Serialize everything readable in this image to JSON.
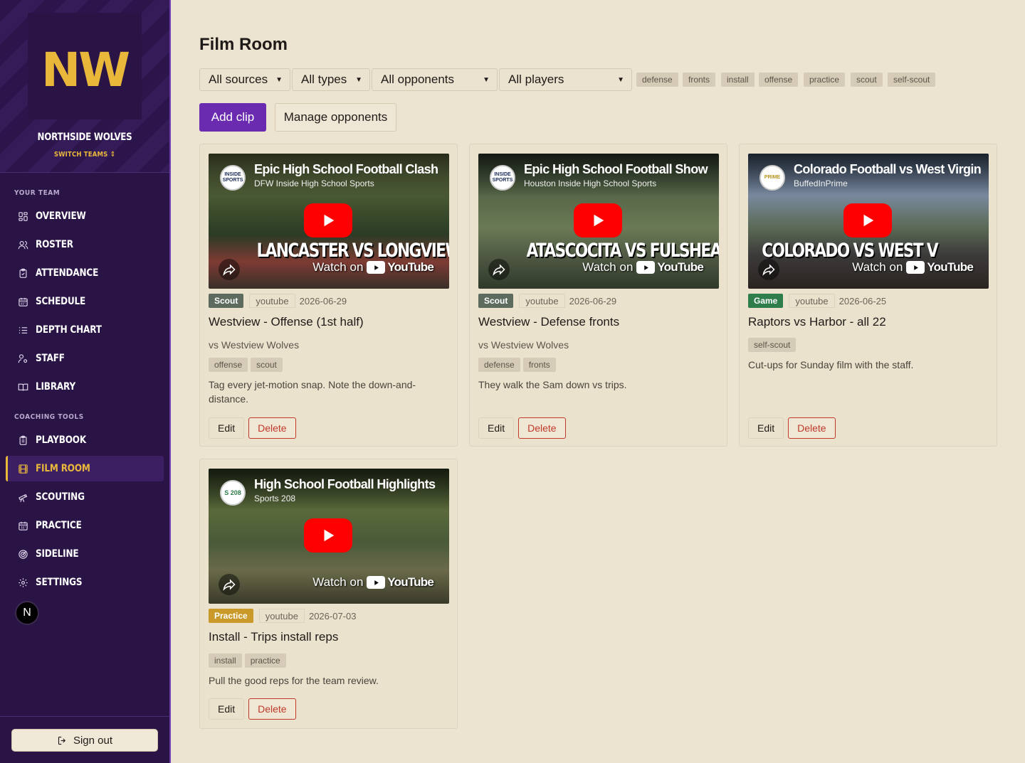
{
  "brand": {
    "logo": "NW",
    "team_name": "NORTHSIDE WOLVES",
    "switch_label": "SWITCH TEAMS"
  },
  "nav": {
    "section_team": "YOUR TEAM",
    "section_tools": "COACHING TOOLS",
    "team_items": [
      {
        "label": "OVERVIEW",
        "icon": "grid-icon"
      },
      {
        "label": "ROSTER",
        "icon": "users-icon"
      },
      {
        "label": "ATTENDANCE",
        "icon": "clipboard-check-icon"
      },
      {
        "label": "SCHEDULE",
        "icon": "calendar-icon"
      },
      {
        "label": "DEPTH CHART",
        "icon": "list-icon"
      },
      {
        "label": "STAFF",
        "icon": "user-key-icon"
      },
      {
        "label": "LIBRARY",
        "icon": "book-icon"
      }
    ],
    "tool_items": [
      {
        "label": "PLAYBOOK",
        "icon": "clipboard-icon"
      },
      {
        "label": "FILM ROOM",
        "icon": "film-icon",
        "active": true
      },
      {
        "label": "SCOUTING",
        "icon": "telescope-icon"
      },
      {
        "label": "PRACTICE",
        "icon": "calendar-grid-icon"
      },
      {
        "label": "SIDELINE",
        "icon": "target-icon"
      },
      {
        "label": "SETTINGS",
        "icon": "gear-icon"
      }
    ],
    "avatar_letter": "N",
    "sign_out": "Sign out"
  },
  "page": {
    "title": "Film Room",
    "filters": {
      "sources": "All sources",
      "types": "All types",
      "opponents": "All opponents",
      "players": "All players"
    },
    "tag_filters": [
      "defense",
      "fronts",
      "install",
      "offense",
      "practice",
      "scout",
      "self-scout"
    ],
    "add_clip": "Add clip",
    "manage_opponents": "Manage opponents"
  },
  "colors": {
    "accent": "#6a2bb0",
    "sidebar": "#2a1446",
    "gold": "#e9b83b",
    "danger": "#c0392b"
  },
  "clips": [
    {
      "video_title": "Epic High School Football Clash",
      "channel": "DFW Inside High School Sports",
      "overlay": "LANCASTER VS LONGVIEW",
      "channel_logo": "INSIDE SPORTS",
      "badge": "Scout",
      "source": "youtube",
      "date": "2026-06-29",
      "title": "Westview - Offense (1st half)",
      "opponent": "vs Westview Wolves",
      "tags": [
        "offense",
        "scout"
      ],
      "note": "Tag every jet-motion snap. Note the down-and-distance.",
      "edit": "Edit",
      "delete": "Delete",
      "watch_on": "Watch on",
      "youtube": "YouTube"
    },
    {
      "video_title": "Epic High School Football Show",
      "channel": "Houston Inside High School Sports",
      "overlay": "ATASCOCITA VS FULSHEAR",
      "channel_logo": "INSIDE SPORTS",
      "badge": "Scout",
      "source": "youtube",
      "date": "2026-06-29",
      "title": "Westview - Defense fronts",
      "opponent": "vs Westview Wolves",
      "tags": [
        "defense",
        "fronts"
      ],
      "note": "They walk the Sam down vs trips.",
      "edit": "Edit",
      "delete": "Delete",
      "watch_on": "Watch on",
      "youtube": "YouTube"
    },
    {
      "video_title": "Colorado Football vs West Virgin",
      "channel": "BuffedInPrime",
      "overlay": "COLORADO VS WEST V",
      "channel_logo": "PRIME",
      "badge": "Game",
      "source": "youtube",
      "date": "2026-06-25",
      "title": "Raptors vs Harbor - all 22",
      "tags": [
        "self-scout"
      ],
      "note": "Cut-ups for Sunday film with the staff.",
      "edit": "Edit",
      "delete": "Delete",
      "watch_on": "Watch on",
      "youtube": "YouTube"
    },
    {
      "video_title": "High School Football Highlights",
      "channel": "Sports 208",
      "overlay": "",
      "channel_logo": "S 208",
      "badge": "Practice",
      "source": "youtube",
      "date": "2026-07-03",
      "title": "Install - Trips install reps",
      "tags": [
        "install",
        "practice"
      ],
      "note": "Pull the good reps for the team review.",
      "edit": "Edit",
      "delete": "Delete",
      "watch_on": "Watch on",
      "youtube": "YouTube"
    }
  ]
}
